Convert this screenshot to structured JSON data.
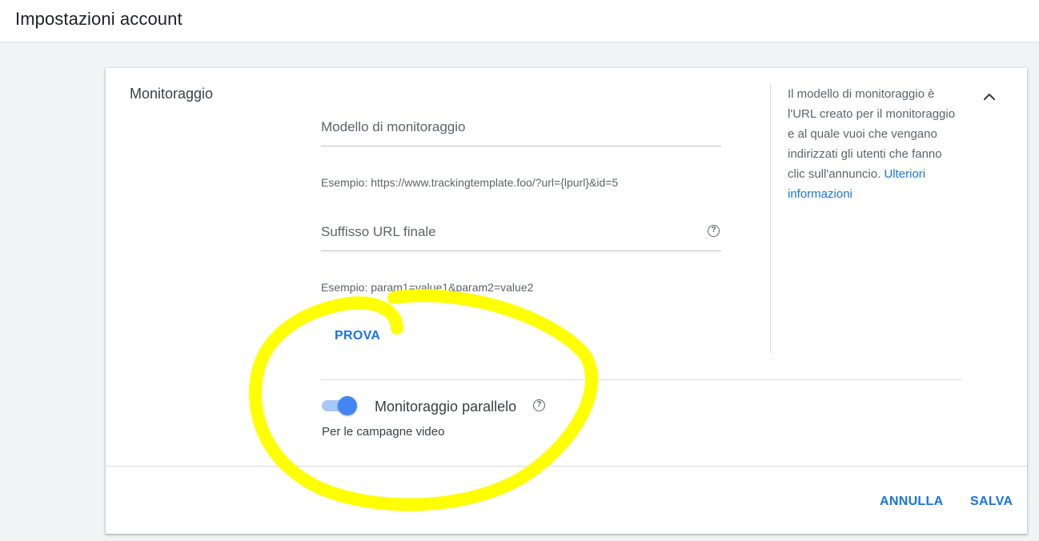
{
  "page": {
    "title": "Impostazioni account"
  },
  "section": {
    "title": "Monitoraggio",
    "tracking_template": {
      "placeholder": "Modello di monitoraggio",
      "value": "",
      "example": "Esempio: https://www.trackingtemplate.foo/?url={lpurl}&id=5"
    },
    "final_url_suffix": {
      "placeholder": "Suffisso URL finale",
      "value": "",
      "help_icon": "?",
      "example": "Esempio: param1=value1&param2=value2"
    },
    "test_label": "PROVA",
    "parallel_tracking": {
      "label": "Monitoraggio parallelo",
      "help_icon": "?",
      "sublabel": "Per le campagne video",
      "enabled": true
    }
  },
  "side_info": {
    "text": "Il modello di monitoraggio è l'URL creato per il monitoraggio e al quale vuoi che vengano indirizzati gli utenti che fanno clic sull'annuncio.",
    "link": "Ulteriori informazioni"
  },
  "actions": {
    "cancel_label": "ANNULLA",
    "save_label": "SALVA"
  },
  "icons": {
    "collapse": "chevron-up-icon",
    "help": "help-circle-icon"
  },
  "colors": {
    "accent": "#1a73e8",
    "toggle_on": "#4285f4",
    "annotation": "#ffff00"
  }
}
